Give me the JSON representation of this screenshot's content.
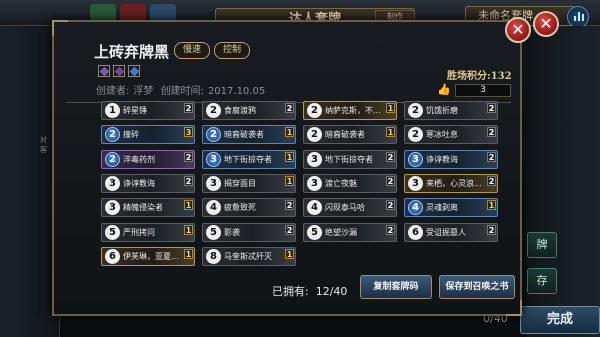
{
  "background": {
    "header_title": "达人套牌",
    "header_tag": "制作",
    "right_label": "未命名套牌",
    "left_note": [
      "对",
      "客"
    ],
    "right_buttons": [
      "牌",
      "存"
    ],
    "card_count": "0/40",
    "done_button": "完成",
    "tab_colors": [
      "#2a5a3a",
      "#6a2020",
      "#2a4a6a"
    ]
  },
  "modal": {
    "deck_name": "上砖弃牌黑",
    "tags": [
      "慢速",
      "控制"
    ],
    "element_icons": [
      {
        "name": "dark-element-icon",
        "color": "#7a5aa8"
      },
      {
        "name": "dark-element-icon",
        "color": "#6a4a98"
      },
      {
        "name": "water-element-icon",
        "color": "#3a7ad8"
      }
    ],
    "creator_label": "创建者:",
    "creator": "浮梦",
    "created_label": "创建时间:",
    "created": "2017.10.05",
    "ladder_score_label": "胜场积分:132",
    "wins": "3",
    "owned_label": "已拥有:",
    "owned_value": "12/40",
    "copy_button": "复制套牌码",
    "save_button": "保存到召唤之书"
  },
  "cards": [
    [
      {
        "cost": "1",
        "name": "碎星锤",
        "count": "2",
        "rarity": "common"
      },
      {
        "cost": "2",
        "name": "撞碎",
        "count": "3",
        "rarity": "rare"
      },
      {
        "cost": "2",
        "name": "淬毒药剂",
        "count": "2",
        "rarity": "epic"
      },
      {
        "cost": "3",
        "name": "诤谆教诲",
        "count": "2",
        "rarity": "common"
      },
      {
        "cost": "3",
        "name": "精魄侵染者",
        "count": "1",
        "rarity": "common"
      },
      {
        "cost": "5",
        "name": "严刑拷问",
        "count": "1",
        "rarity": "common"
      },
      {
        "cost": "6",
        "name": "伊芙琳，亚夏...",
        "count": "1",
        "rarity": "legend"
      }
    ],
    [
      {
        "cost": "2",
        "name": "食腐渡鸦",
        "count": "2",
        "rarity": "common"
      },
      {
        "cost": "2",
        "name": "暗裔破袭者",
        "count": "1",
        "rarity": "rare"
      },
      {
        "cost": "3",
        "name": "地下街掠夺者",
        "count": "1",
        "rarity": "rare"
      },
      {
        "cost": "3",
        "name": "揭穿面目",
        "count": "1",
        "rarity": "common"
      },
      {
        "cost": "4",
        "name": "疲惫致死",
        "count": "2",
        "rarity": "common"
      },
      {
        "cost": "5",
        "name": "影袭",
        "count": "2",
        "rarity": "common"
      },
      {
        "cost": "8",
        "name": "马奎斯忒歼灭",
        "count": "1",
        "rarity": "common"
      }
    ],
    [
      {
        "cost": "2",
        "name": "纳萨克斯，不...",
        "count": "1",
        "rarity": "legend"
      },
      {
        "cost": "2",
        "name": "暗裔破袭者",
        "count": "1",
        "rarity": "common"
      },
      {
        "cost": "3",
        "name": "地下街掠夺者",
        "count": "2",
        "rarity": "common"
      },
      {
        "cost": "3",
        "name": "渡亡夜魅",
        "count": "2",
        "rarity": "common"
      },
      {
        "cost": "4",
        "name": "闪现泰马哈",
        "count": "2",
        "rarity": "common"
      },
      {
        "cost": "5",
        "name": "绝望沙漏",
        "count": "2",
        "rarity": "common"
      }
    ],
    [
      {
        "cost": "2",
        "name": "饥饿折磨",
        "count": "2",
        "rarity": "common"
      },
      {
        "cost": "2",
        "name": "寒冰吐息",
        "count": "2",
        "rarity": "common"
      },
      {
        "cost": "3",
        "name": "诤谆教诲",
        "count": "2",
        "rarity": "rare"
      },
      {
        "cost": "3",
        "name": "来栖，心灵浪...",
        "count": "2",
        "rarity": "legend"
      },
      {
        "cost": "4",
        "name": "灵魂剥离",
        "count": "1",
        "rarity": "rare"
      },
      {
        "cost": "6",
        "name": "受诅掘墓人",
        "count": "2",
        "rarity": "common"
      }
    ]
  ]
}
